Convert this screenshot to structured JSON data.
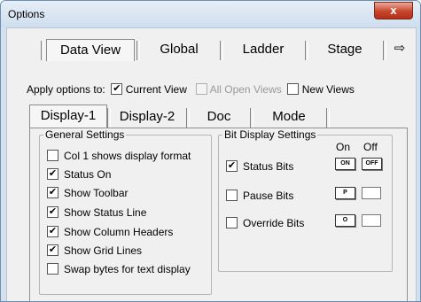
{
  "window": {
    "title": "Options",
    "close_glyph": "x"
  },
  "top_tabs": [
    {
      "label": "Data View",
      "selected": true
    },
    {
      "label": "Global",
      "selected": false
    },
    {
      "label": "Ladder",
      "selected": false
    },
    {
      "label": "Stage",
      "selected": false
    }
  ],
  "scroll_arrow": "⇨",
  "apply_row": {
    "label": "Apply options to:",
    "current_view": {
      "label": "Current View",
      "checked": true,
      "enabled": true
    },
    "all_open_views": {
      "label": "All Open Views",
      "checked": false,
      "enabled": false
    },
    "new_views": {
      "label": "New Views",
      "checked": false,
      "enabled": true
    }
  },
  "inner_tabs": [
    {
      "label": "Display-1",
      "selected": true
    },
    {
      "label": "Display-2",
      "selected": false
    },
    {
      "label": "Doc",
      "selected": false
    },
    {
      "label": "Mode",
      "selected": false
    }
  ],
  "general_settings": {
    "title": "General Settings",
    "options": [
      {
        "label": "Col 1 shows display format",
        "checked": false
      },
      {
        "label": "Status On",
        "checked": true
      },
      {
        "label": "Show Toolbar",
        "checked": true
      },
      {
        "label": "Show Status Line",
        "checked": true
      },
      {
        "label": "Show Column Headers",
        "checked": true
      },
      {
        "label": "Show Grid Lines",
        "checked": true
      },
      {
        "label": "Swap bytes for text display",
        "checked": false
      }
    ]
  },
  "bit_display": {
    "title": "Bit Display Settings",
    "on_header": "On",
    "off_header": "Off",
    "rows": [
      {
        "label": "Status Bits",
        "checked": true,
        "on_icon": "ON",
        "off_icon": "OFF"
      },
      {
        "label": "Pause Bits",
        "checked": false,
        "on_icon": "P",
        "off_icon": ""
      },
      {
        "label": "Override Bits",
        "checked": false,
        "on_icon": "O",
        "off_icon": ""
      }
    ]
  }
}
